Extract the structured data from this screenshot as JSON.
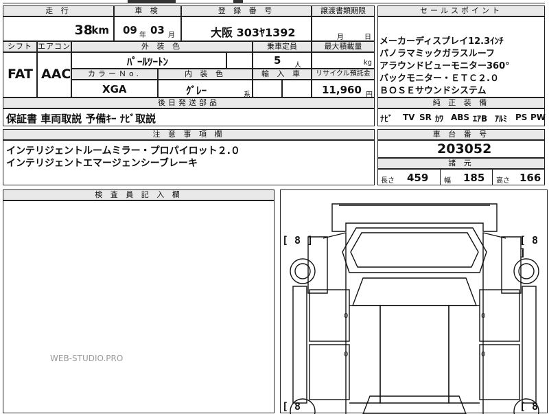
{
  "table_top": {
    "mileage_label": "走 行",
    "mileage_value": "38",
    "mileage_unit": "km",
    "inspection_label": "車 検",
    "inspection_year": "09",
    "inspection_year_unit": "年",
    "inspection_month": "03",
    "inspection_month_unit": "月",
    "registration_label": "登 録 番 号",
    "registration_value": "大阪 303ﾔ1392",
    "transfer_label": "譲渡書類期限",
    "transfer_month_unit": "月",
    "transfer_day_unit": "日"
  },
  "sales_points": {
    "label": "セールスポイント",
    "lines": [
      "メーカーディスプレイ12.3ｲﾝﾁ",
      "パノラマミックガラスルーフ",
      "アラウンドビューモニター360°",
      "バックモニター・ＥＴＣ２.０",
      "ＢＯＳＥサウンドシステム"
    ]
  },
  "row2": {
    "shift_label": "シフト",
    "shift_value": "FAT",
    "ac_label": "エアコン",
    "ac_value": "AAC",
    "exterior_label": "外 装 色",
    "exterior_value": "ﾊﾟｰﾙﾂｰﾄﾝ",
    "capacity_label": "乗車定員",
    "capacity_value": "5",
    "capacity_unit": "人",
    "max_load_label": "最大積載量",
    "max_load_unit": "kg",
    "color_no_label": "カラーＮo.",
    "color_no_value": "XGA",
    "interior_label": "内 装 色",
    "interior_value": "ｸﾞﾚｰ",
    "interior_suffix": "系",
    "import_label": "輸 入 車",
    "recycle_label": "リサイクル預託金",
    "recycle_value": "11,960",
    "recycle_unit": "円"
  },
  "docs": {
    "label": "後日発送部品",
    "value": "保証書 車両取説 予備ｷｰ ﾅﾋﾞ取説"
  },
  "equipment": {
    "label": "純 正 装 備",
    "items": [
      "ﾅﾋﾞ",
      "TV",
      "SR",
      "ｶﾜ",
      "ABS",
      "ｴｱB",
      "ｱﾙﾐ",
      "PS",
      "PW"
    ]
  },
  "notes": {
    "label": "注 意 事 項 欄",
    "lines": [
      "インテリジェントルームミラー・プロパイロット２.０",
      "インテリジェントエマージェンシーブレーキ"
    ]
  },
  "chassis": {
    "label": "車 台 番 号",
    "value": "203052"
  },
  "specs": {
    "label": "諸 元",
    "length_label": "長さ",
    "length_value": "459",
    "width_label": "幅",
    "width_value": "185",
    "height_label": "高さ",
    "height_value": "166"
  },
  "inspector": {
    "label": "検 査 員 記 入 欄"
  },
  "diagram": {
    "tire_left_top": "[ 8 ]",
    "tire_right_top": "[ 8 ]",
    "tire_left_bottom": "[ 8",
    "tire_right_bottom": "[ 8",
    "door_marks": [
      "0",
      "0",
      "0",
      "0"
    ]
  },
  "watermark": "WEB-STUDIO.PRO"
}
